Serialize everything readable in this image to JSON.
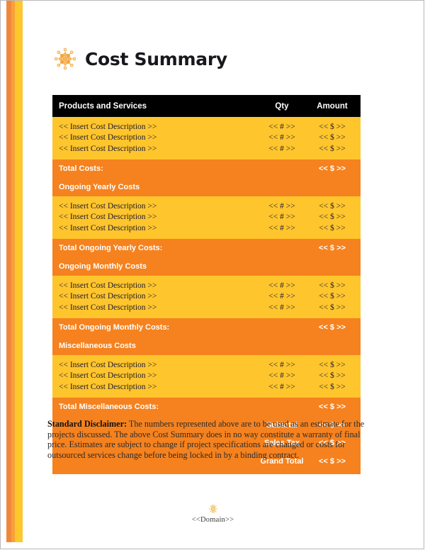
{
  "document": {
    "title": "Cost Summary",
    "logo_icon": "atom-starburst-icon",
    "accent_colors": {
      "black_header": "#000000",
      "amber_rows": "#FFC52C",
      "orange_totals": "#F5821F",
      "stripe_orange": "#F0883A",
      "stripe_gold": "#FFC62E"
    }
  },
  "table": {
    "headers": {
      "description": "Products and Services",
      "qty": "Qty",
      "amount": "Amount"
    },
    "placeholder": {
      "description": "<< Insert Cost Description >>",
      "qty": "<< # >>",
      "amount": "<< $ >>"
    },
    "sections": [
      {
        "rows": [
          {
            "description": "<< Insert Cost Description >>",
            "qty": "<< # >>",
            "amount": "<< $ >>"
          },
          {
            "description": "<< Insert Cost Description >>",
            "qty": "<< # >>",
            "amount": "<< $ >>"
          },
          {
            "description": "<< Insert Cost Description >>",
            "qty": "<< # >>",
            "amount": "<< $ >>"
          }
        ],
        "total_label": "Total Costs:",
        "total_amount": "<< $ >>",
        "next_section_label": "Ongoing Yearly Costs"
      },
      {
        "rows": [
          {
            "description": "<< Insert Cost Description >>",
            "qty": "<< # >>",
            "amount": "<< $ >>"
          },
          {
            "description": "<< Insert Cost Description >>",
            "qty": "<< # >>",
            "amount": "<< $ >>"
          },
          {
            "description": "<< Insert Cost Description >>",
            "qty": "<< # >>",
            "amount": "<< $ >>"
          }
        ],
        "total_label": "Total Ongoing Yearly Costs:",
        "total_amount": "<< $ >>",
        "next_section_label": "Ongoing Monthly Costs"
      },
      {
        "rows": [
          {
            "description": "<< Insert Cost Description >>",
            "qty": "<< # >>",
            "amount": "<< $ >>"
          },
          {
            "description": "<< Insert Cost Description >>",
            "qty": "<< # >>",
            "amount": "<< $ >>"
          },
          {
            "description": "<< Insert Cost Description >>",
            "qty": "<< # >>",
            "amount": "<< $ >>"
          }
        ],
        "total_label": "Total Ongoing Monthly Costs:",
        "total_amount": "<< $ >>",
        "next_section_label": "Miscellaneous Costs"
      },
      {
        "rows": [
          {
            "description": "<< Insert Cost Description >>",
            "qty": "<< # >>",
            "amount": "<< $ >>"
          },
          {
            "description": "<< Insert Cost Description >>",
            "qty": "<< # >>",
            "amount": "<< $ >>"
          },
          {
            "description": "<< Insert Cost Description >>",
            "qty": "<< # >>",
            "amount": "<< $ >>"
          }
        ],
        "total_label": "Total Miscellaneous Costs:",
        "total_amount": "<< $ >>",
        "next_section_label": null
      }
    ],
    "summary": [
      {
        "label": "Subtotal",
        "amount": "<< $ >>"
      },
      {
        "label": "Sales Tax",
        "amount": "<< $ >>"
      },
      {
        "label": "Grand Total",
        "amount": "<< $ >>"
      }
    ]
  },
  "disclaimer": {
    "lead": "Standard Disclaimer:",
    "body": " The numbers represented above are to be used as an estimate for the projects discussed. The above Cost Summary does in no way constitute a warranty of final price.  Estimates are subject to change if project specifications are changed or costs for outsourced services change before being locked in by a binding contract."
  },
  "footer": {
    "icon": "sun-starburst-icon",
    "text": "<<Domain>>"
  }
}
